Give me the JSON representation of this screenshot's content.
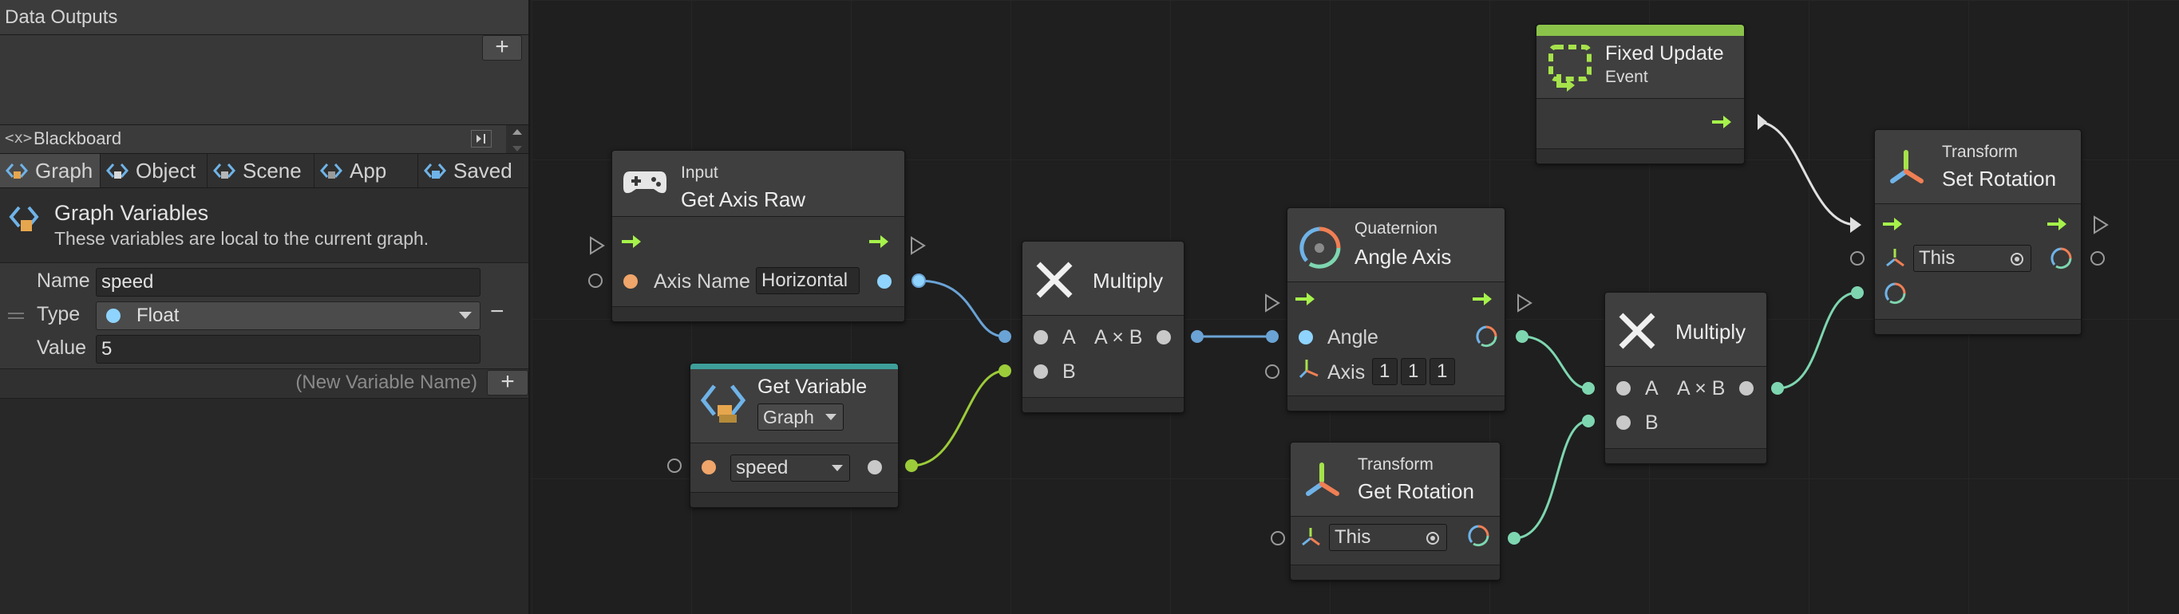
{
  "data_outputs": {
    "title": "Data Outputs",
    "add_label": "+"
  },
  "blackboard": {
    "code_glyph": "<x>",
    "title": "Blackboard",
    "tabs": [
      {
        "label": "Graph",
        "icon": "graph-icon"
      },
      {
        "label": "Object",
        "icon": "object-icon"
      },
      {
        "label": "Scene",
        "icon": "scene-icon"
      },
      {
        "label": "App",
        "icon": "app-icon"
      },
      {
        "label": "Saved",
        "icon": "saved-icon"
      }
    ],
    "section_title": "Graph Variables",
    "section_desc": "These variables are local to the current graph.",
    "variable": {
      "name_label": "Name",
      "name_value": "speed",
      "type_label": "Type",
      "type_value": "Float",
      "value_label": "Value",
      "value_value": "5",
      "remove_label": "−"
    },
    "new_var_placeholder": "(New Variable Name)",
    "add_label": "+"
  },
  "nodes": {
    "get_axis_raw": {
      "subtitle": "Input",
      "title": "Get Axis Raw",
      "param_label": "Axis Name",
      "param_value": "Horizontal"
    },
    "get_variable": {
      "title": "Get Variable",
      "scope": "Graph",
      "var_value": "speed"
    },
    "multiply1": {
      "title": "Multiply",
      "in_a": "A",
      "in_b": "B",
      "out": "A × B"
    },
    "fixed_update": {
      "title": "Fixed Update",
      "subtitle": "Event"
    },
    "angle_axis": {
      "subtitle": "Quaternion",
      "title": "Angle Axis",
      "angle_label": "Angle",
      "axis_label": "Axis",
      "axis_values": [
        "1",
        "1",
        "1"
      ]
    },
    "get_rotation": {
      "subtitle": "Transform",
      "title": "Get Rotation",
      "target": "This"
    },
    "multiply2": {
      "title": "Multiply",
      "in_a": "A",
      "in_b": "B",
      "out": "A × B"
    },
    "set_rotation": {
      "subtitle": "Transform",
      "title": "Set Rotation",
      "target": "This"
    }
  },
  "colors": {
    "flow": "#a6f24b",
    "float": "#8fd3ff",
    "string": "#f0a56a",
    "quaternion": "#7ed6b0",
    "object_wire": "#9ccc3a",
    "event_header": "#8bc34a",
    "variable_header": "#3e9e9a"
  }
}
